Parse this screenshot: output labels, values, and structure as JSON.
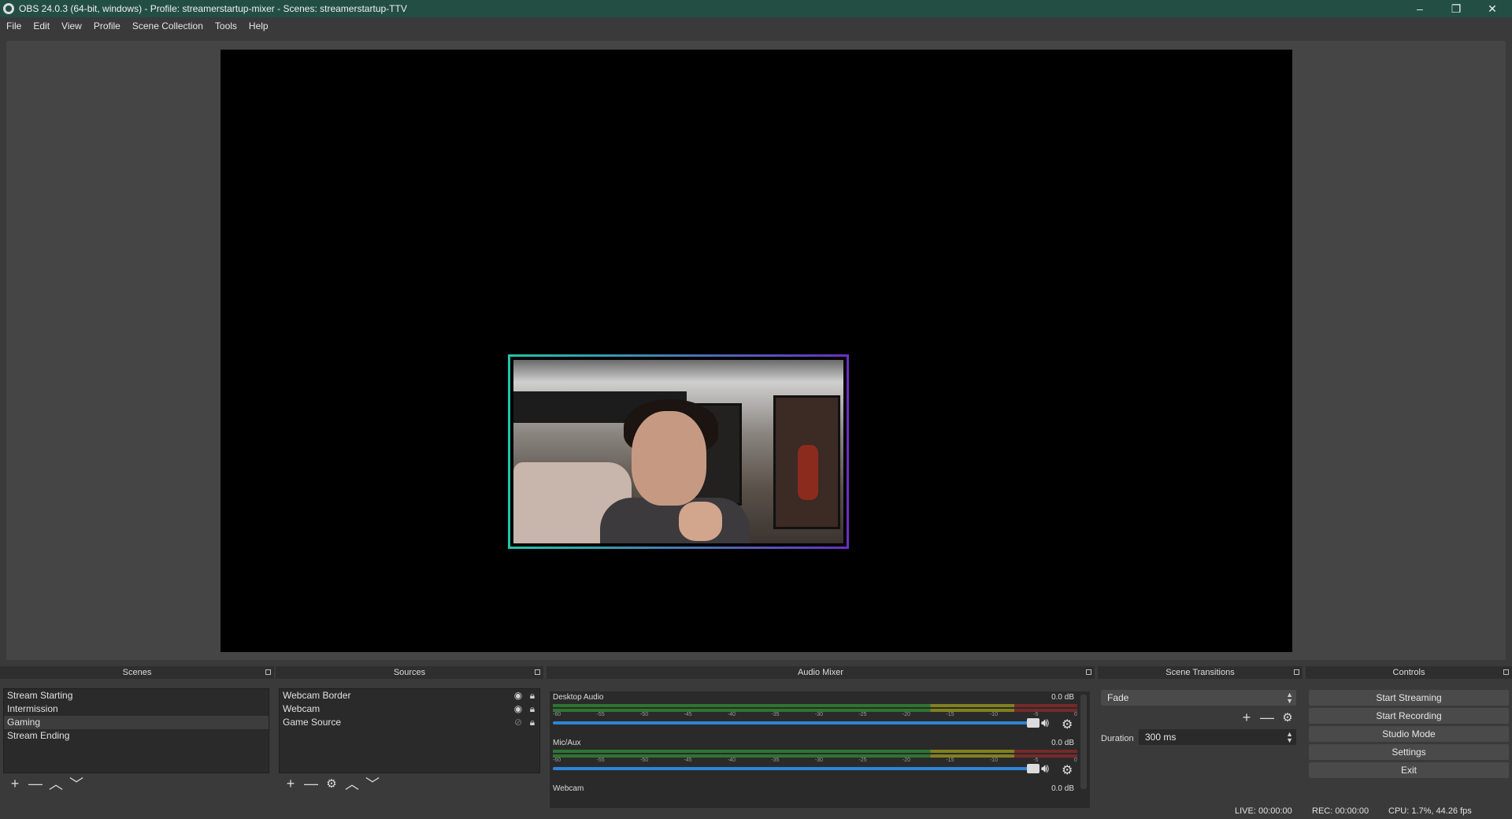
{
  "window": {
    "title": "OBS 24.0.3 (64-bit, windows) - Profile: streamerstartup-mixer - Scenes: streamerstartup-TTV",
    "minimize": "–",
    "restore": "❐",
    "close": "✕"
  },
  "menu": [
    "File",
    "Edit",
    "View",
    "Profile",
    "Scene Collection",
    "Tools",
    "Help"
  ],
  "docks": {
    "scenes": "Scenes",
    "sources": "Sources",
    "mixer": "Audio Mixer",
    "transitions": "Scene Transitions",
    "controls": "Controls"
  },
  "scenes": [
    "Stream Starting",
    "Intermission",
    "Gaming",
    "Stream Ending"
  ],
  "selected_scene": "Gaming",
  "sources": [
    {
      "name": "Webcam Border",
      "visible": true,
      "locked": true
    },
    {
      "name": "Webcam",
      "visible": true,
      "locked": true
    },
    {
      "name": "Game Source",
      "visible": false,
      "locked": true
    }
  ],
  "toolbar_glyphs": {
    "add": "+",
    "remove": "—",
    "settings": "⚙",
    "up": "︿",
    "down": "﹀"
  },
  "mixer": {
    "tracks": [
      {
        "name": "Desktop Audio",
        "db": "0.0 dB"
      },
      {
        "name": "Mic/Aux",
        "db": "0.0 dB"
      },
      {
        "name": "Webcam",
        "db": "0.0 dB"
      }
    ],
    "ticks": [
      "-60",
      "-55",
      "-50",
      "-45",
      "-40",
      "-35",
      "-30",
      "-25",
      "-20",
      "-15",
      "-10",
      "-5",
      "0"
    ],
    "mute_icon": "speaker-icon",
    "settings_icon": "gear-icon"
  },
  "transitions": {
    "selected": "Fade",
    "duration_label": "Duration",
    "duration_value": "300 ms"
  },
  "controls": [
    "Start Streaming",
    "Start Recording",
    "Studio Mode",
    "Settings",
    "Exit"
  ],
  "status": {
    "live": "LIVE: 00:00:00",
    "rec": "REC: 00:00:00",
    "cpu": "CPU: 1.7%, 44.26 fps"
  },
  "colors": {
    "title_bar": "#234e44",
    "border_start": "#22c6a8",
    "border_end": "#6b2fc0",
    "slider": "#2f84d6"
  }
}
